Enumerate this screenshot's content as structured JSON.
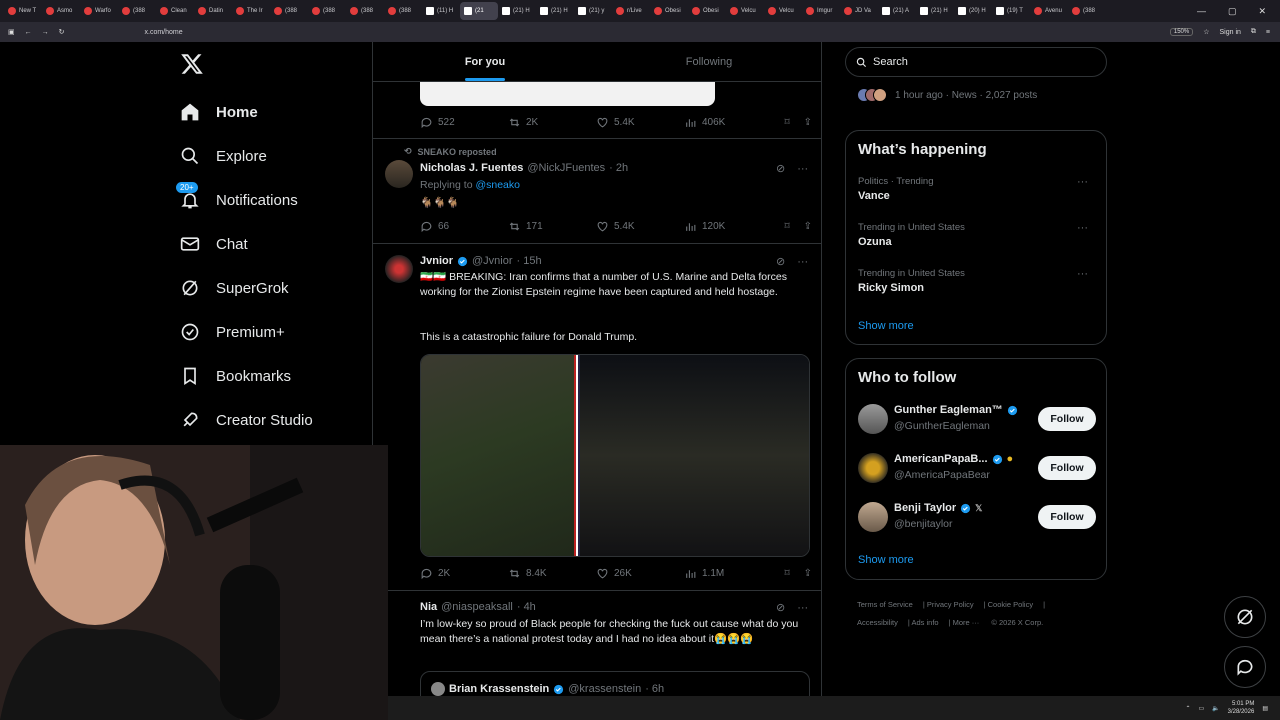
{
  "browser": {
    "tabs": [
      {
        "label": "New T",
        "icon": "firefox-icon"
      },
      {
        "label": "Asmo",
        "icon": "youtube-icon"
      },
      {
        "label": "Warfo",
        "icon": "youtube-icon"
      },
      {
        "label": "(388",
        "icon": "youtube-icon"
      },
      {
        "label": "Clean",
        "icon": "youtube-icon"
      },
      {
        "label": "Datin",
        "icon": "youtube-icon"
      },
      {
        "label": "The Ir",
        "icon": "youtube-icon"
      },
      {
        "label": "(388",
        "icon": "youtube-icon"
      },
      {
        "label": "(388",
        "icon": "youtube-icon"
      },
      {
        "label": "(388",
        "icon": "youtube-icon"
      },
      {
        "label": "(388",
        "icon": "youtube-icon"
      },
      {
        "label": "(11) H",
        "icon": "x-icon"
      },
      {
        "label": "(21",
        "icon": "x-icon",
        "active": true
      },
      {
        "label": "(21) H",
        "icon": "x-icon"
      },
      {
        "label": "(21) H",
        "icon": "x-icon"
      },
      {
        "label": "(21) y",
        "icon": "x-icon"
      },
      {
        "label": "r/Live",
        "icon": "reddit-icon"
      },
      {
        "label": "Obesi",
        "icon": "web-icon"
      },
      {
        "label": "Obesi",
        "icon": "web-icon"
      },
      {
        "label": "Velcu",
        "icon": "web-icon"
      },
      {
        "label": "Velcu",
        "icon": "web-icon"
      },
      {
        "label": "Imgur",
        "icon": "web-icon"
      },
      {
        "label": "JD Va",
        "icon": "web-icon"
      },
      {
        "label": "(21) A",
        "icon": "x-icon"
      },
      {
        "label": "(21) H",
        "icon": "x-icon"
      },
      {
        "label": "(20) H",
        "icon": "x-icon"
      },
      {
        "label": "(19) T",
        "icon": "x-icon"
      },
      {
        "label": "Avenu",
        "icon": "web-icon"
      },
      {
        "label": "(388",
        "icon": "youtube-icon"
      }
    ],
    "url": "x.com/home",
    "zoom": "150%",
    "sign_in": "Sign in"
  },
  "nav": {
    "items": [
      {
        "label": "Home",
        "icon": "home-icon",
        "active": true
      },
      {
        "label": "Explore",
        "icon": "search-icon"
      },
      {
        "label": "Notifications",
        "icon": "bell-icon",
        "badge": "20+"
      },
      {
        "label": "Chat",
        "icon": "mail-icon"
      },
      {
        "label": "SuperGrok",
        "icon": "grok-icon"
      },
      {
        "label": "Premium+",
        "icon": "premium-icon"
      },
      {
        "label": "Bookmarks",
        "icon": "bookmark-icon"
      },
      {
        "label": "Creator Studio",
        "icon": "rocket-icon"
      }
    ]
  },
  "feed": {
    "tabs": [
      {
        "label": "For you",
        "active": true
      },
      {
        "label": "Following"
      }
    ],
    "prev_actions": {
      "replies": "522",
      "reposts": "2K",
      "likes": "5.4K",
      "views": "406K"
    },
    "tweet1": {
      "repost_by": "SNEAKO reposted",
      "name": "Nicholas J. Fuentes",
      "handle": "@NickJFuentes",
      "time": "· 2h",
      "reply_prefix": "Replying to",
      "reply_handle": "@sneako",
      "text": "🐐🐐🐐",
      "replies": "66",
      "reposts": "171",
      "likes": "5.4K",
      "views": "120K"
    },
    "tweet2": {
      "name": "Jvnior",
      "handle": "@Jvnior",
      "time": "· 15h",
      "text1": "🇮🇷🇮🇷 BREAKING: Iran confirms that a number of U.S. Marine and Delta forces working for the Zionist Epstein regime have been captured and held hostage.",
      "text2": "This is a catastrophic failure for Donald Trump.",
      "replies": "2K",
      "reposts": "8.4K",
      "likes": "26K",
      "views": "1.1M"
    },
    "tweet3": {
      "name": "Nia",
      "handle": "@niaspeaksall",
      "time": "· 4h",
      "text": "I’m low-key so proud of Black people for checking the fuck out cause what do you mean there’s a national protest today and I had no idea about it😭😭😭",
      "quote_name": "Brian Krassenstein",
      "quote_handle": "@krassenstein",
      "quote_time": "· 6h"
    }
  },
  "right": {
    "search_placeholder": "Search",
    "news_meta": "1 hour ago · News · 2,027 posts",
    "happening": {
      "title": "What’s happening",
      "trends": [
        {
          "meta": "Politics · Trending",
          "topic": "Vance"
        },
        {
          "meta": "Trending in United States",
          "topic": "Ozuna"
        },
        {
          "meta": "Trending in United States",
          "topic": "Ricky Simon"
        }
      ],
      "show_more": "Show more"
    },
    "who_to_follow": {
      "title": "Who to follow",
      "users": [
        {
          "name": "Gunther Eagleman™",
          "handle": "@GuntherEagleman",
          "button": "Follow"
        },
        {
          "name": "AmericanPapaB...",
          "handle": "@AmericaPapaBear",
          "button": "Follow"
        },
        {
          "name": "Benji Taylor",
          "handle": "@benjitaylor",
          "button": "Follow"
        }
      ],
      "show_more": "Show more"
    },
    "footer": [
      "Terms of Service",
      "Privacy Policy",
      "Cookie Policy",
      "Accessibility",
      "Ads info",
      "More ···",
      "© 2026 X Corp."
    ]
  },
  "taskbar": {
    "time": "5:01 PM",
    "date": "3/28/2026"
  },
  "colors": {
    "accent": "#1d9bf0",
    "border": "#2f3336",
    "muted": "#71767b"
  }
}
